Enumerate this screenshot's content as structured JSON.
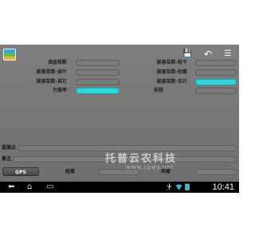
{
  "toolbar": {
    "icons": [
      "save-icon",
      "undo-icon",
      "list-icon"
    ],
    "glyphs": {
      "save": "💾",
      "undo": "↶",
      "list": "☰"
    }
  },
  "form": {
    "left": [
      {
        "label": "调查株数",
        "value": "",
        "highlighted": false
      },
      {
        "label": "被害苗数-食叶",
        "value": "",
        "highlighted": false
      },
      {
        "label": "被害苗数-其它",
        "value": "",
        "highlighted": false
      },
      {
        "label": "为害率",
        "value": "",
        "highlighted": true
      }
    ],
    "right": [
      {
        "label": "被害苗数-蛀干",
        "value": "",
        "highlighted": false
      },
      {
        "label": "被害苗数-枯萎",
        "value": "",
        "highlighted": false
      },
      {
        "label": "被害苗数-合计",
        "value": "",
        "highlighted": true
      },
      {
        "label": "前程",
        "value": "",
        "highlighted": false
      }
    ]
  },
  "location": {
    "label": "监测点",
    "value": ""
  },
  "remark": {
    "label": "备注",
    "value": ""
  },
  "gps": {
    "button_label": "GPS",
    "longitude_label": "经度",
    "longitude_value": "",
    "latitude_label": "纬度",
    "latitude_value": ""
  },
  "watermark": {
    "text": "托普云农科技",
    "url": "www.tpwy.net"
  },
  "system_bar": {
    "nav_icons": [
      "back-icon",
      "home-icon",
      "recent-apps-icon"
    ],
    "nav_glyphs": {
      "back": "⬅",
      "home": "⌂",
      "recent": "▭"
    },
    "clock": "10:41",
    "accent": "#33b5e5"
  },
  "colors": {
    "panel": "#7a7a7a",
    "highlight": "#2fd6dc"
  }
}
